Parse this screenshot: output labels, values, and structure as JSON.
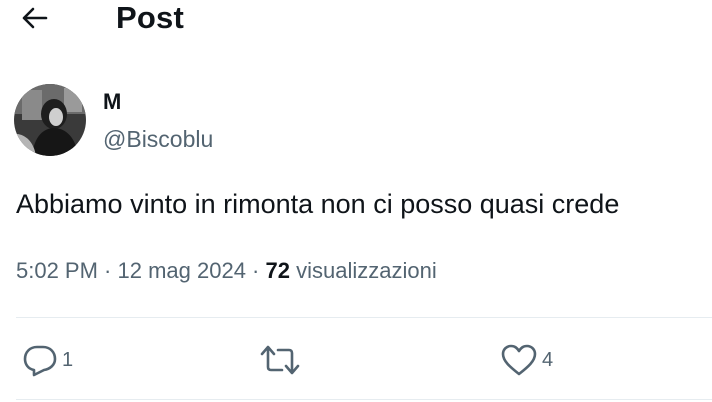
{
  "header": {
    "title": "Post",
    "back_icon": "arrow-left-icon"
  },
  "author": {
    "display_name": "M",
    "handle": "@Biscoblu",
    "avatar_icon": "profile-photo"
  },
  "tweet": {
    "text": "Abbiamo vinto in rimonta non ci posso quasi crede",
    "time": "5:02 PM",
    "separator1": " · ",
    "date": "12 mag 2024",
    "separator2": " · ",
    "views_count": "72",
    "views_label": " visualizzazioni"
  },
  "actions": {
    "reply": {
      "icon": "reply-icon",
      "count": "1"
    },
    "retweet": {
      "icon": "retweet-icon",
      "count": ""
    },
    "like": {
      "icon": "heart-icon",
      "count": "4"
    }
  },
  "colors": {
    "text_primary": "#0f1419",
    "text_secondary": "#536471",
    "divider": "#e6ecf0",
    "background": "#ffffff"
  }
}
